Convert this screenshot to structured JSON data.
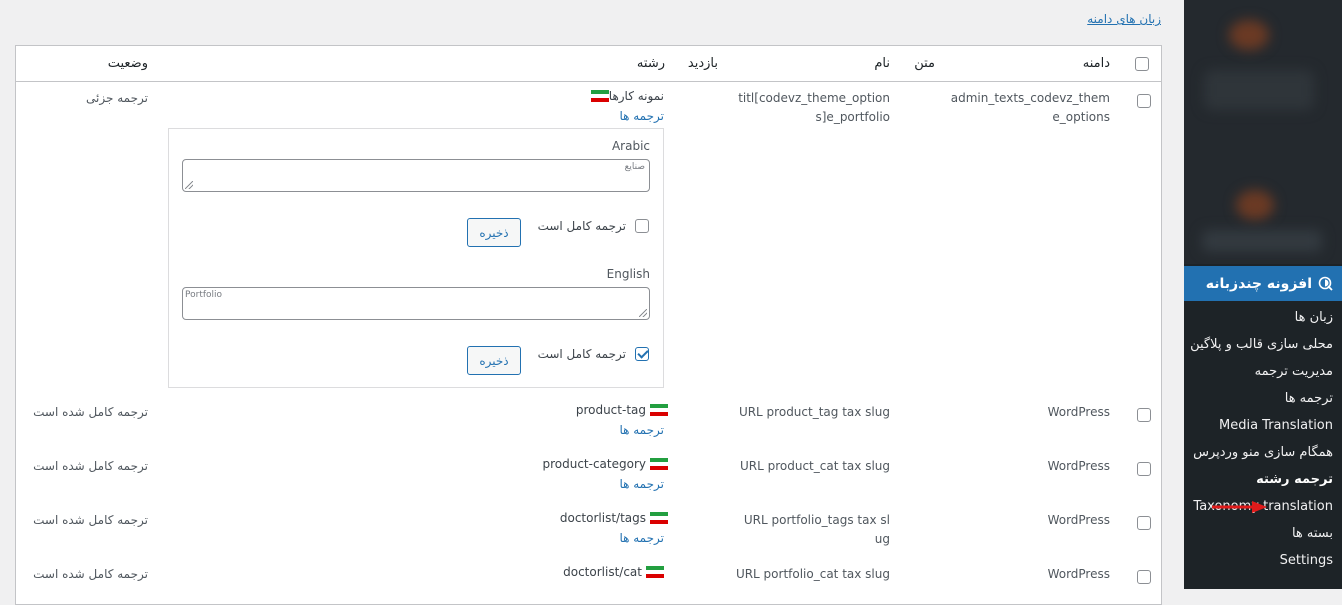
{
  "top_link": "زبان های دامنه",
  "table": {
    "headers": {
      "domain": "دامنه",
      "text": "متن",
      "name": "نام",
      "visits": "بازدید",
      "string": "رشته",
      "status": "وضعیت"
    },
    "rows": [
      {
        "domain": "admin_texts_codevz_theme_options",
        "name": "titl[codevz_theme_options]e_portfolio",
        "string": "نمونه کارها",
        "translations_link": "ترجمه ها",
        "status": "ترجمه جزئی"
      },
      {
        "domain": "WordPress",
        "name": "URL product_tag tax slug",
        "string": "product-tag",
        "translations_link": "ترجمه ها",
        "status": "ترجمه کامل شده است"
      },
      {
        "domain": "WordPress",
        "name": "URL product_cat tax slug",
        "string": "product-category",
        "translations_link": "ترجمه ها",
        "status": "ترجمه کامل شده است"
      },
      {
        "domain": "WordPress",
        "name": "URL portfolio_tags tax slug",
        "string": "doctorlist/tags",
        "translations_link": "ترجمه ها",
        "status": "ترجمه کامل شده است"
      },
      {
        "domain": "WordPress",
        "name": "URL portfolio_cat tax slug",
        "string": "doctorlist/cat",
        "status": "ترجمه کامل شده است"
      }
    ],
    "editor": {
      "translations": [
        {
          "language": "Arabic",
          "value": "صنایع",
          "complete_label": "ترجمه کامل است",
          "complete": false,
          "save_label": "ذخیره"
        },
        {
          "language": "English",
          "value": "Portfolio",
          "complete_label": "ترجمه کامل است",
          "complete": true,
          "save_label": "ذخیره"
        }
      ]
    }
  },
  "sidebar": {
    "active_menu": "افزونه چندزبانه",
    "items": [
      "زبان ها",
      "محلی سازی قالب و پلاگین",
      "مدیریت ترجمه",
      "ترجمه ها",
      "Media Translation",
      "همگام سازی منو وردپرس",
      "ترجمه رشته",
      "Taxonomy translation",
      "بسته ها",
      "Settings"
    ],
    "current_item": "ترجمه رشته"
  },
  "colors": {
    "accent": "#2271b1",
    "sidebar_bg": "#1d2327",
    "annotation_arrow": "#e01b1b"
  }
}
